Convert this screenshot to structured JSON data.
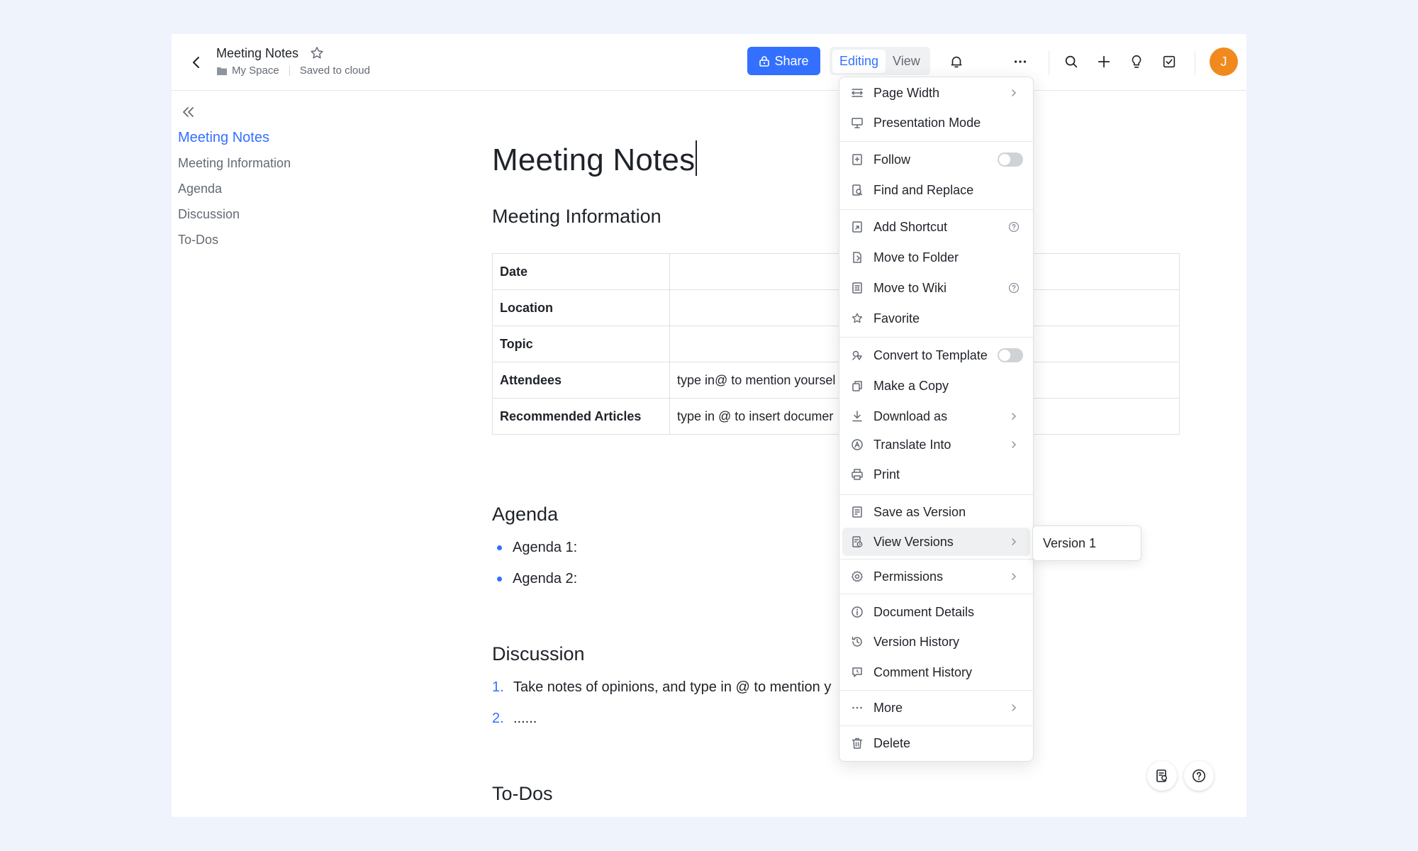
{
  "header": {
    "title": "Meeting Notes",
    "location": "My Space",
    "save_status": "Saved to cloud",
    "share_label": "Share",
    "mode_editing": "Editing",
    "mode_view": "View",
    "avatar_initial": "J"
  },
  "outline": {
    "items": [
      "Meeting Notes",
      "Meeting Information",
      "Agenda",
      "Discussion",
      "To-Dos"
    ]
  },
  "document": {
    "title": "Meeting Notes",
    "section_info": "Meeting Information",
    "table": [
      {
        "key": "Date",
        "value": ""
      },
      {
        "key": "Location",
        "value": ""
      },
      {
        "key": "Topic",
        "value": ""
      },
      {
        "key": "Attendees",
        "value": "type in@ to mention yoursel"
      },
      {
        "key": "Recommended Articles",
        "value": "type in @ to insert documer"
      }
    ],
    "section_agenda": "Agenda",
    "agenda": [
      "Agenda 1:",
      "Agenda 2:"
    ],
    "section_discussion": "Discussion",
    "discussion": [
      {
        "num": "1.",
        "text": "Take notes of opinions, and type in @ to mention y"
      },
      {
        "num": "2.",
        "text": "......"
      }
    ],
    "section_todos": "To-Dos"
  },
  "menu": {
    "items": [
      {
        "label": "Page Width",
        "icon": "page-width-icon"
      },
      {
        "label": "Presentation Mode",
        "icon": "presentation-icon"
      },
      {
        "label": "Follow",
        "icon": "follow-icon",
        "toggle_on": false
      },
      {
        "label": "Find and Replace",
        "icon": "find-replace-icon"
      },
      {
        "label": "Add Shortcut",
        "icon": "shortcut-icon"
      },
      {
        "label": "Move to Folder",
        "icon": "move-folder-icon"
      },
      {
        "label": "Move to Wiki",
        "icon": "wiki-icon"
      },
      {
        "label": "Favorite",
        "icon": "star-icon"
      },
      {
        "label": "Convert to Template",
        "icon": "template-icon",
        "toggle_on": false
      },
      {
        "label": "Make a Copy",
        "icon": "copy-icon"
      },
      {
        "label": "Download as",
        "icon": "download-icon"
      },
      {
        "label": "Translate Into",
        "icon": "translate-icon"
      },
      {
        "label": "Print",
        "icon": "print-icon"
      },
      {
        "label": "Save as Version",
        "icon": "save-version-icon"
      },
      {
        "label": "View Versions",
        "icon": "view-versions-icon"
      },
      {
        "label": "Permissions",
        "icon": "gear-icon"
      },
      {
        "label": "Document Details",
        "icon": "info-icon"
      },
      {
        "label": "Version History",
        "icon": "history-icon"
      },
      {
        "label": "Comment History",
        "icon": "comment-history-icon"
      },
      {
        "label": "More",
        "icon": "more-dots-icon"
      },
      {
        "label": "Delete",
        "icon": "trash-icon"
      }
    ],
    "submenu_version": "Version 1"
  }
}
